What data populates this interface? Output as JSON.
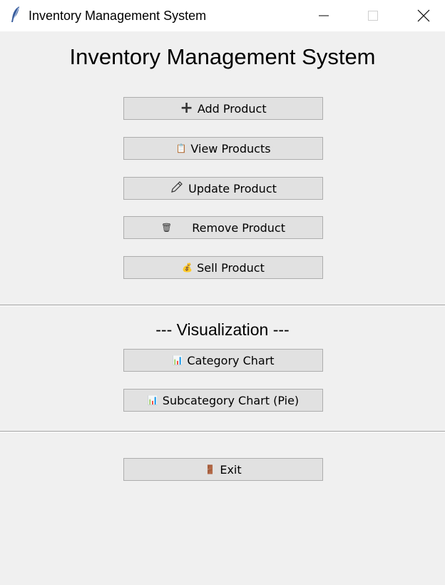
{
  "window": {
    "title": "Inventory Management System",
    "controls": [
      "minimize",
      "maximize",
      "close"
    ]
  },
  "header": {
    "title": "Inventory Management System"
  },
  "actions": [
    {
      "label": "Add Product",
      "icon": "plus-icon"
    },
    {
      "label": "View Products",
      "icon": "clipboard-icon"
    },
    {
      "label": "Update Product",
      "icon": "pencil-icon"
    },
    {
      "label": "Remove Product",
      "icon": "trash-icon"
    },
    {
      "label": "Sell Product",
      "icon": "money-bag-icon"
    }
  ],
  "visualization": {
    "title": "--- Visualization ---",
    "buttons": [
      {
        "label": "Category Chart",
        "icon": "bar-chart-icon"
      },
      {
        "label": "Subcategory Chart (Pie)",
        "icon": "bar-chart-icon"
      }
    ]
  },
  "exit": {
    "label": "Exit",
    "icon": "door-icon"
  }
}
